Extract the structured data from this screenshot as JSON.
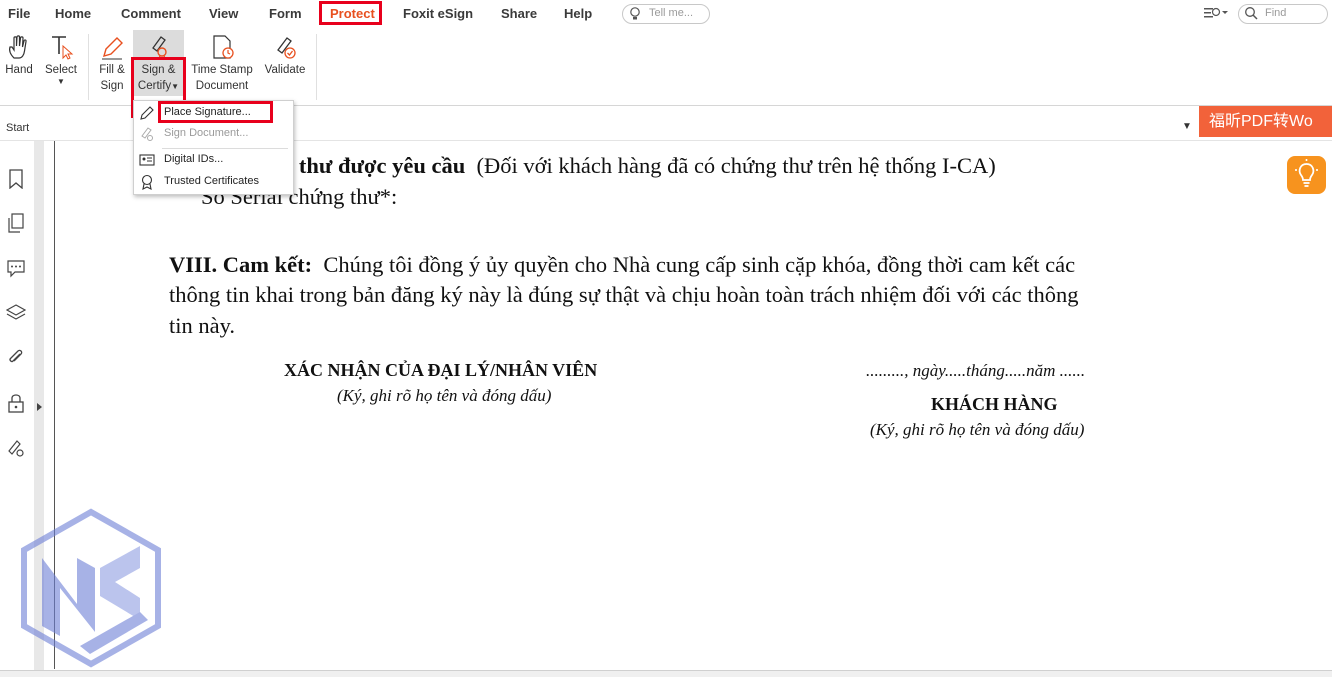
{
  "menu": {
    "file": "File",
    "home": "Home",
    "comment": "Comment",
    "view": "View",
    "form": "Form",
    "protect": "Protect",
    "esign": "Foxit eSign",
    "share": "Share",
    "help": "Help"
  },
  "tell_me": {
    "placeholder": "Tell me..."
  },
  "find": {
    "placeholder": "Find"
  },
  "ribbon": {
    "hand": "Hand",
    "select": "Select",
    "fill_sign_1": "Fill &",
    "fill_sign_2": "Sign",
    "sign_certify_1": "Sign &",
    "sign_certify_2": "Certify",
    "timestamp_1": "Time Stamp",
    "timestamp_2": "Document",
    "validate": "Validate"
  },
  "dropdown": {
    "place_signature": "Place Signature...",
    "sign_document": "Sign Document...",
    "digital_ids": "Digital IDs...",
    "trusted_certs": "Trusted Certificates"
  },
  "startbar": {
    "label": "Start"
  },
  "ad_banner": "福昕PDF转Wo",
  "document": {
    "line1_bold": "g thư được yêu cầu",
    "line1_rest": "(Đối với khách hàng đã có chứng thư trên hệ thống I-CA)",
    "line2": "Số Serial chứng thư*:",
    "section_bold": "VIII. Cam kết:",
    "section_text": "Chúng tôi đồng ý ủy quyền cho Nhà cung cấp sinh cặp khóa, đồng thời cam kết các",
    "section_line2": "thông tin khai trong bản đăng ký này là đúng sự thật và chịu hoàn toàn trách nhiệm đối với các thông",
    "section_line3": "tin này.",
    "agent_title": "XÁC NHẬN CỦA ĐẠI LÝ/NHÂN VIÊN",
    "agent_sub": "(Ký, ghi rõ họ tên và đóng dấu)",
    "date_line": "........., ngày.....tháng.....năm ......",
    "customer_title": "KHÁCH HÀNG",
    "customer_sub": "(Ký, ghi rõ họ tên và đóng dấu)"
  },
  "colors": {
    "accent": "#e8501f",
    "highlight": "#e8001c",
    "tip_bulb": "#f7931e",
    "ad": "#f2623a"
  }
}
